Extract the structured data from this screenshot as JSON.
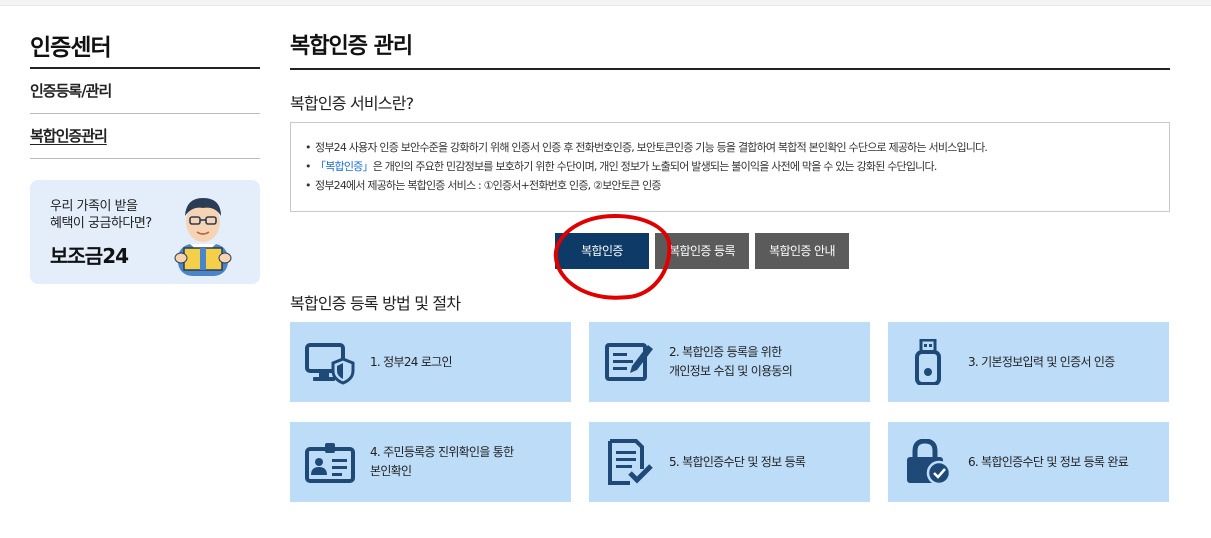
{
  "sidebar": {
    "title": "인증센터",
    "items": [
      {
        "label": "인증등록/관리"
      },
      {
        "label": "복합인증관리"
      }
    ],
    "banner": {
      "line1": "우리 가족이 받을",
      "line2": "혜택이 궁금하다면?",
      "brand": "보조금24"
    }
  },
  "main": {
    "title": "복합인증 관리",
    "intro_title": "복합인증 서비스란?",
    "notice": {
      "line1": "정부24 사용자 인증 보안수준을 강화하기 위해 인증서 인증 후 전화번호인증, 보안토큰인증 기능 등을 결합하여 복합적 본인확인 수단으로 제공하는 서비스입니다.",
      "line2_highlight": "「복합인증」",
      "line2_rest": "은 개인의 주요한 민감정보를 보호하기 위한 수단이며, 개인 정보가 노출되어 발생되는 불이익을 사전에 막을 수 있는 강화된 수단입니다.",
      "line3": "정부24에서 제공하는 복합인증 서비스 : ①인증서+전화번호 인증, ②보안토큰 인증"
    },
    "tabs": [
      {
        "label": "복합인증"
      },
      {
        "label": "복합인증 등록"
      },
      {
        "label": "복합인증 안내"
      }
    ],
    "steps_title": "복합인증 등록 방법 및 절차",
    "steps": [
      {
        "line1": "1. 정부24 로그인",
        "line2": "",
        "icon": "monitor-shield-icon"
      },
      {
        "line1": "2. 복합인증 등록을 위한",
        "line2": "개인정보 수집 및 이용동의",
        "icon": "form-pen-icon"
      },
      {
        "line1": "3. 기본정보입력 및 인증서 인증",
        "line2": "",
        "icon": "usb-token-icon"
      },
      {
        "line1": "4. 주민등록증 진위확인을 통한",
        "line2": "본인확인",
        "icon": "id-card-icon"
      },
      {
        "line1": "5. 복합인증수단 및 정보 등록",
        "line2": "",
        "icon": "document-check-icon"
      },
      {
        "line1": "6. 복합인증수단 및 정보 등록 완료",
        "line2": "",
        "icon": "lock-check-icon"
      }
    ]
  },
  "colors": {
    "active_tab": "#0d3a66",
    "tab": "#5b5b5b",
    "card_bg": "#bddcf7",
    "icon": "#1f4a78",
    "highlight": "#1a6cd1",
    "annotation_circle": "#e00000"
  }
}
